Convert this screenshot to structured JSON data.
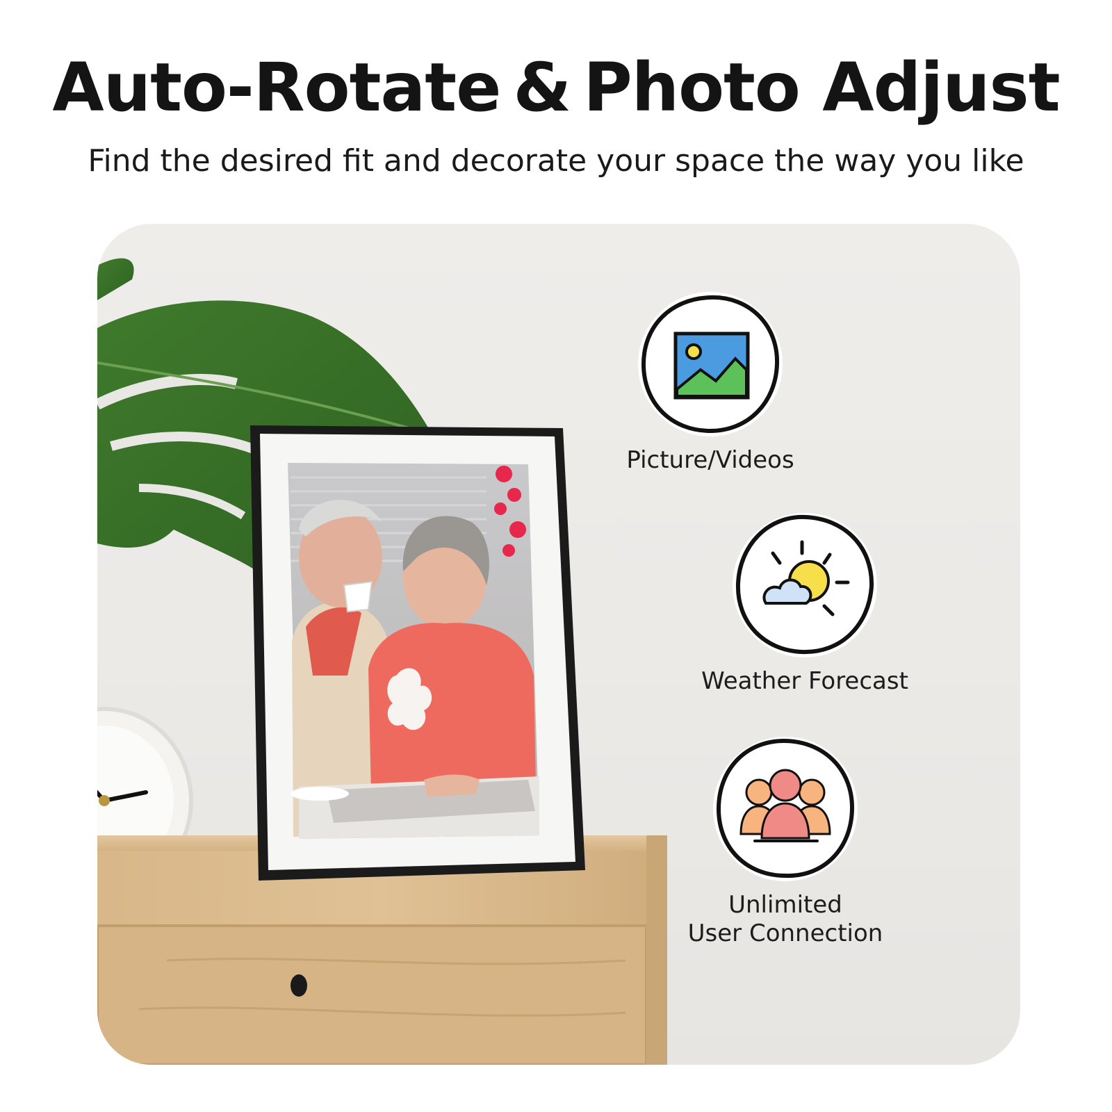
{
  "headline": "Auto-Rotate & Photo Adjust",
  "subheadline": "Find the desired fit and decorate your space the way you like",
  "features": [
    {
      "label": "Picture/Videos",
      "icon": "picture-icon"
    },
    {
      "label": "Weather Forecast",
      "icon": "weather-icon"
    },
    {
      "label_line1": "Unlimited",
      "label_line2": "User Connection",
      "icon": "users-icon"
    }
  ],
  "colors": {
    "sky": "#4a9be0",
    "grass": "#5dc15a",
    "sun": "#f6df4a",
    "cloud": "#cfe2f7",
    "people_front": "#f08a86",
    "people_back": "#f7b47e",
    "frame": "#1b1b1b",
    "wood": "#d9b98c"
  }
}
